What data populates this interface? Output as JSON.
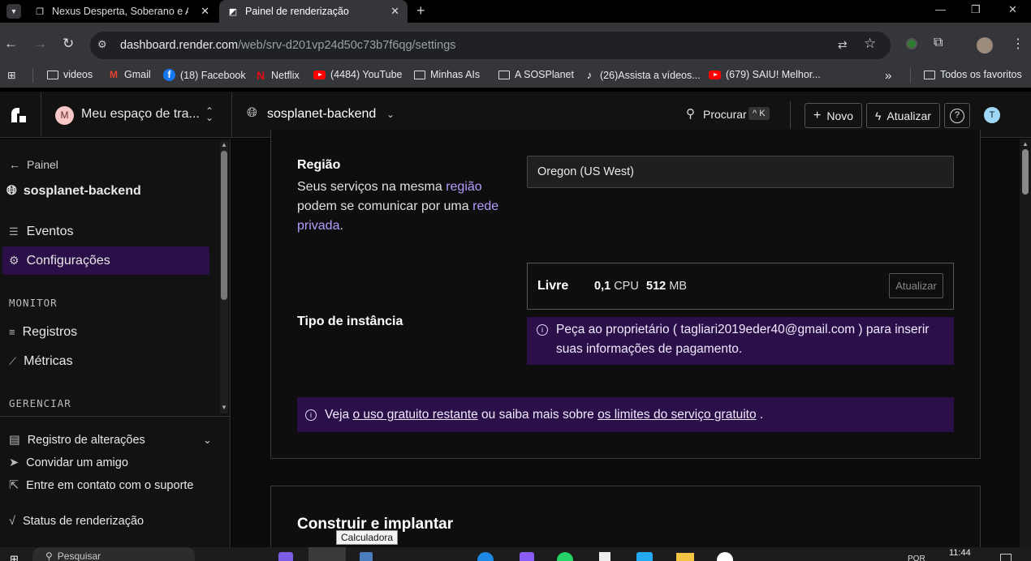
{
  "browser": {
    "tabs": [
      {
        "title": "Nexus Desperta, Soberano e Au"
      },
      {
        "title": "Painel de renderização"
      }
    ],
    "url_host": "dashboard.render.com",
    "url_path": "/web/srv-d201vp24d50c73b7f6qg/settings",
    "bookmarks": [
      {
        "label": "videos",
        "icon": "folder-icon"
      },
      {
        "label": "Gmail",
        "icon": "gmail-icon"
      },
      {
        "label": "(18) Facebook",
        "icon": "facebook-icon"
      },
      {
        "label": "Netflix",
        "icon": "netflix-icon"
      },
      {
        "label": "(4484) YouTube",
        "icon": "youtube-icon"
      },
      {
        "label": "Minhas AIs",
        "icon": "folder-icon"
      },
      {
        "label": "A SOSPlanet",
        "icon": "folder-icon"
      },
      {
        "label": "(26)Assista a vídeos...",
        "icon": "tiktok-icon"
      },
      {
        "label": "(679) SAIU! Melhor...",
        "icon": "youtube-icon"
      }
    ],
    "all_bookmarks": "Todos os favoritos",
    "more_bookmarks": "»"
  },
  "header": {
    "workspace_initial": "M",
    "workspace_name": "Meu espaço de tra...",
    "service_name": "sosplanet-backend",
    "search_label": "Procurar",
    "search_shortcut": "^ K",
    "new_label": "Novo",
    "update_label": "Atualizar",
    "help_label": "?",
    "user_initial": "T"
  },
  "sidebar": {
    "back_label": "Painel",
    "service_name": "sosplanet-backend",
    "items": [
      {
        "label": "Eventos"
      },
      {
        "label": "Configurações"
      }
    ],
    "monitor_title": "MONITOR",
    "monitor_items": [
      {
        "label": "Registros"
      },
      {
        "label": "Métricas"
      }
    ],
    "manage_title": "GERENCIAR",
    "footer_items": [
      {
        "label": "Registro de alterações"
      },
      {
        "label": "Convidar um amigo"
      },
      {
        "label": "Entre em contato com o suporte"
      },
      {
        "label": "Status de renderização"
      }
    ]
  },
  "main": {
    "region": {
      "label": "Região",
      "desc_1": "Seus serviços na mesma ",
      "desc_link_1": "região",
      "desc_2": "podem se comunicar por uma ",
      "desc_link_2": "rede",
      "desc_link_3": "privada",
      "desc_end": ".",
      "value": "Oregon (US West)"
    },
    "instance": {
      "label": "Tipo de instância",
      "plan_name": "Livre",
      "cpu_value": "0,1",
      "cpu_unit": "CPU",
      "mem_value": "512",
      "mem_unit": "MB",
      "update_button": "Atualizar",
      "owner_notice": "Peça ao proprietário ( tagliari2019eder40@gmail.com ) para inserir suas informações de pagamento."
    },
    "free_notice": {
      "prefix": "Veja ",
      "link_1": "o uso gratuito restante",
      "middle": " ou saiba mais sobre ",
      "link_2": "os limites do serviço gratuito",
      "suffix": " ."
    },
    "build_title": "Construir e implantar"
  },
  "taskbar": {
    "search_placeholder": "Pesquisar",
    "tooltip": "Calculadora",
    "clock": "11:44",
    "lang": "POR"
  }
}
